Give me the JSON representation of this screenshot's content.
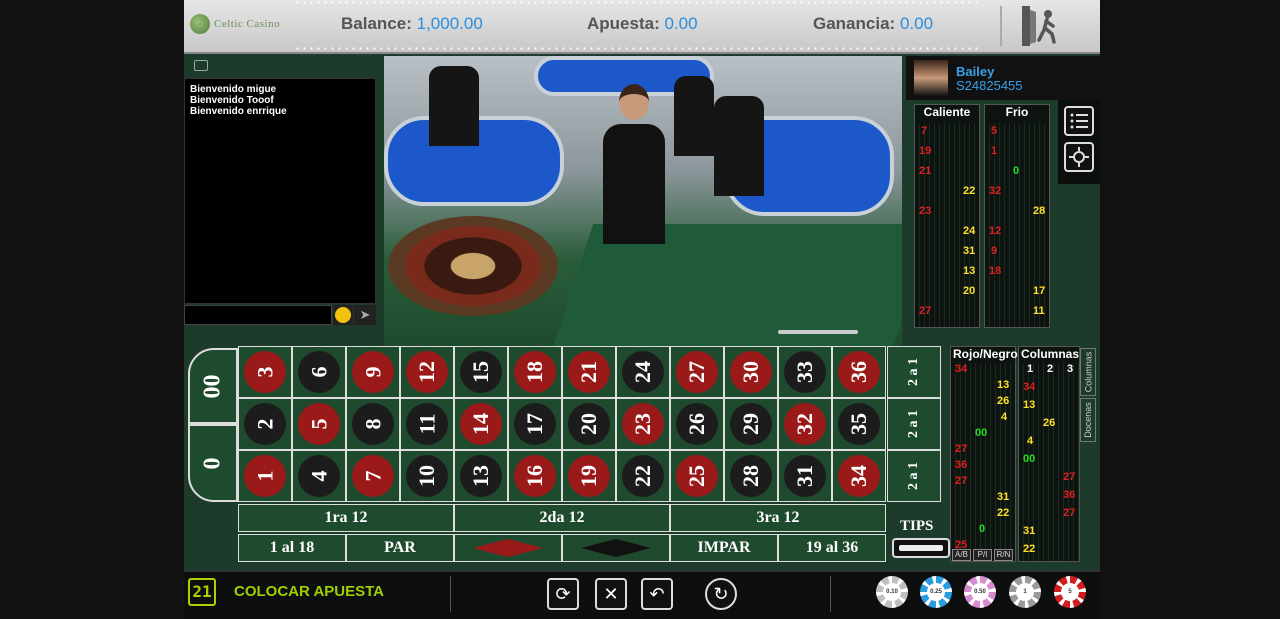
{
  "header": {
    "logo_text": "Celtic Casino",
    "balance_label": "Balance:",
    "balance_value": "1,000.00",
    "bet_label": "Apuesta:",
    "bet_value": "0.00",
    "win_label": "Ganancia:",
    "win_value": "0.00",
    "exit_icon": "exit-door-icon"
  },
  "chat": {
    "messages": [
      "Bienvenido migue",
      "Bienvenido Tooof",
      "Bienvenido enrrique"
    ],
    "input_placeholder": "",
    "emoji_icon": "smiley-icon",
    "send_icon": "send-arrow-icon"
  },
  "dealer": {
    "name": "Bailey",
    "id": "S24825455"
  },
  "stats": {
    "hot_label": "Caliente",
    "cold_label": "Frio",
    "hot_numbers": [
      "7",
      "19",
      "21",
      "22",
      "23",
      "24",
      "31",
      "13",
      "20",
      "27"
    ],
    "cold_numbers": [
      "5",
      "1",
      "0",
      "32",
      "28",
      "12",
      "9",
      "18",
      "17",
      "11"
    ]
  },
  "side_icons": [
    "list-icon",
    "settings-gear-icon"
  ],
  "board": {
    "zeros": [
      "00",
      "0"
    ],
    "row_top": [
      "3",
      "6",
      "9",
      "12",
      "15",
      "18",
      "21",
      "24",
      "27",
      "30",
      "33",
      "36"
    ],
    "row_mid": [
      "2",
      "5",
      "8",
      "11",
      "14",
      "17",
      "20",
      "23",
      "26",
      "29",
      "32",
      "35"
    ],
    "row_bot": [
      "1",
      "4",
      "7",
      "10",
      "13",
      "16",
      "19",
      "22",
      "25",
      "28",
      "31",
      "34"
    ],
    "column_bet": "2 a 1",
    "dozens": [
      "1ra 12",
      "2da 12",
      "3ra 12"
    ],
    "low": "1 al 18",
    "even": "PAR",
    "odd": "IMPAR",
    "high": "19 al 36",
    "red_color": "#9a1a1a",
    "black_color": "#1c1c1c",
    "tips_label": "TIPS"
  },
  "red_black_stats": {
    "title": "Rojo/Negro",
    "values": [
      "34",
      "13",
      "26",
      "4",
      "00",
      "27",
      "36",
      "27",
      "31",
      "22",
      "0",
      "25"
    ],
    "buttons": [
      "A/B",
      "P/I",
      "R/N"
    ]
  },
  "columns_stats": {
    "title": "Columnas",
    "headers": [
      "1",
      "2",
      "3"
    ],
    "values": [
      "34",
      "13",
      "26",
      "4",
      "00",
      "27",
      "36",
      "27",
      "31",
      "22"
    ]
  },
  "right_tabs": [
    "Columnas",
    "Docenas"
  ],
  "footer": {
    "timer": "21",
    "status": "COLOCAR APUESTA",
    "controls": [
      "repeat-icon",
      "clear-icon",
      "undo-icon",
      "auto-icon"
    ],
    "chips": [
      {
        "label": "0.10",
        "color": "#c0c0c0"
      },
      {
        "label": "0.25",
        "color": "#2a9de0"
      },
      {
        "label": "0.50",
        "color": "#d98bd0"
      },
      {
        "label": "1",
        "color": "#9a9a9a"
      },
      {
        "label": "5",
        "color": "#d01e1e"
      }
    ]
  }
}
